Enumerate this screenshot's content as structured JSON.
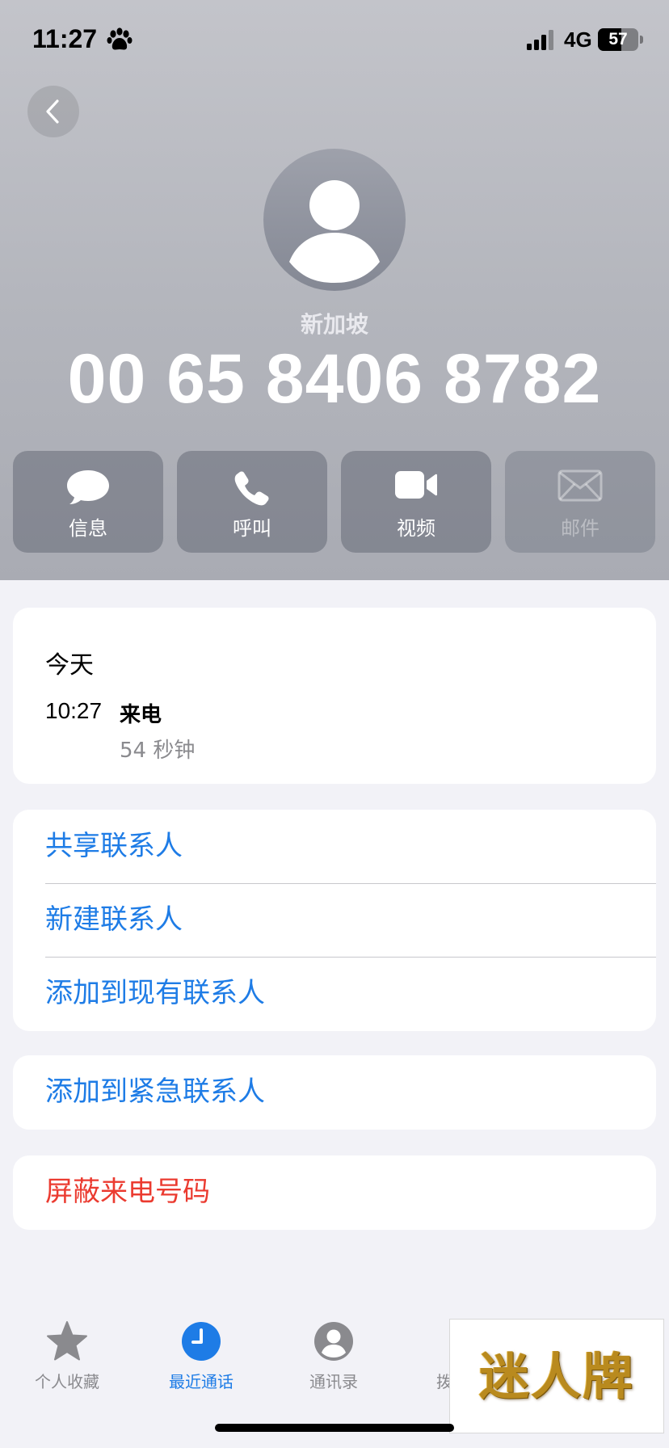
{
  "status_bar": {
    "time": "11:27",
    "network": "4G",
    "battery_percent": "57",
    "battery_level": 0.57,
    "icons": [
      "paw-icon",
      "signal-icon",
      "battery-icon"
    ]
  },
  "contact": {
    "label": "新加坡",
    "phone_number": "00 65 8406 8782"
  },
  "actions": [
    {
      "label": "信息",
      "icon": "message-icon",
      "enabled": true
    },
    {
      "label": "呼叫",
      "icon": "phone-icon",
      "enabled": true
    },
    {
      "label": "视频",
      "icon": "video-icon",
      "enabled": true
    },
    {
      "label": "邮件",
      "icon": "mail-icon",
      "enabled": false
    }
  ],
  "recent": {
    "date": "今天",
    "time": "10:27",
    "type": "来电",
    "duration": "54 秒钟"
  },
  "menu": {
    "share_contact": "共享联系人",
    "new_contact": "新建联系人",
    "add_to_existing": "添加到现有联系人",
    "add_to_emergency": "添加到紧急联系人",
    "block_caller": "屏蔽来电号码"
  },
  "tabs": [
    {
      "label": "个人收藏",
      "icon": "star-icon",
      "active": false
    },
    {
      "label": "最近通话",
      "icon": "clock-icon",
      "active": true
    },
    {
      "label": "通讯录",
      "icon": "person-circle-icon",
      "active": false
    },
    {
      "label": "拨",
      "icon": "keypad-icon",
      "active": false
    }
  ],
  "watermark": {
    "text": "迷人牌"
  },
  "colors": {
    "accent": "#1e7ce6",
    "danger": "#eb3b30",
    "secondary_text": "#8a8a8e",
    "background": "#f2f2f7"
  }
}
